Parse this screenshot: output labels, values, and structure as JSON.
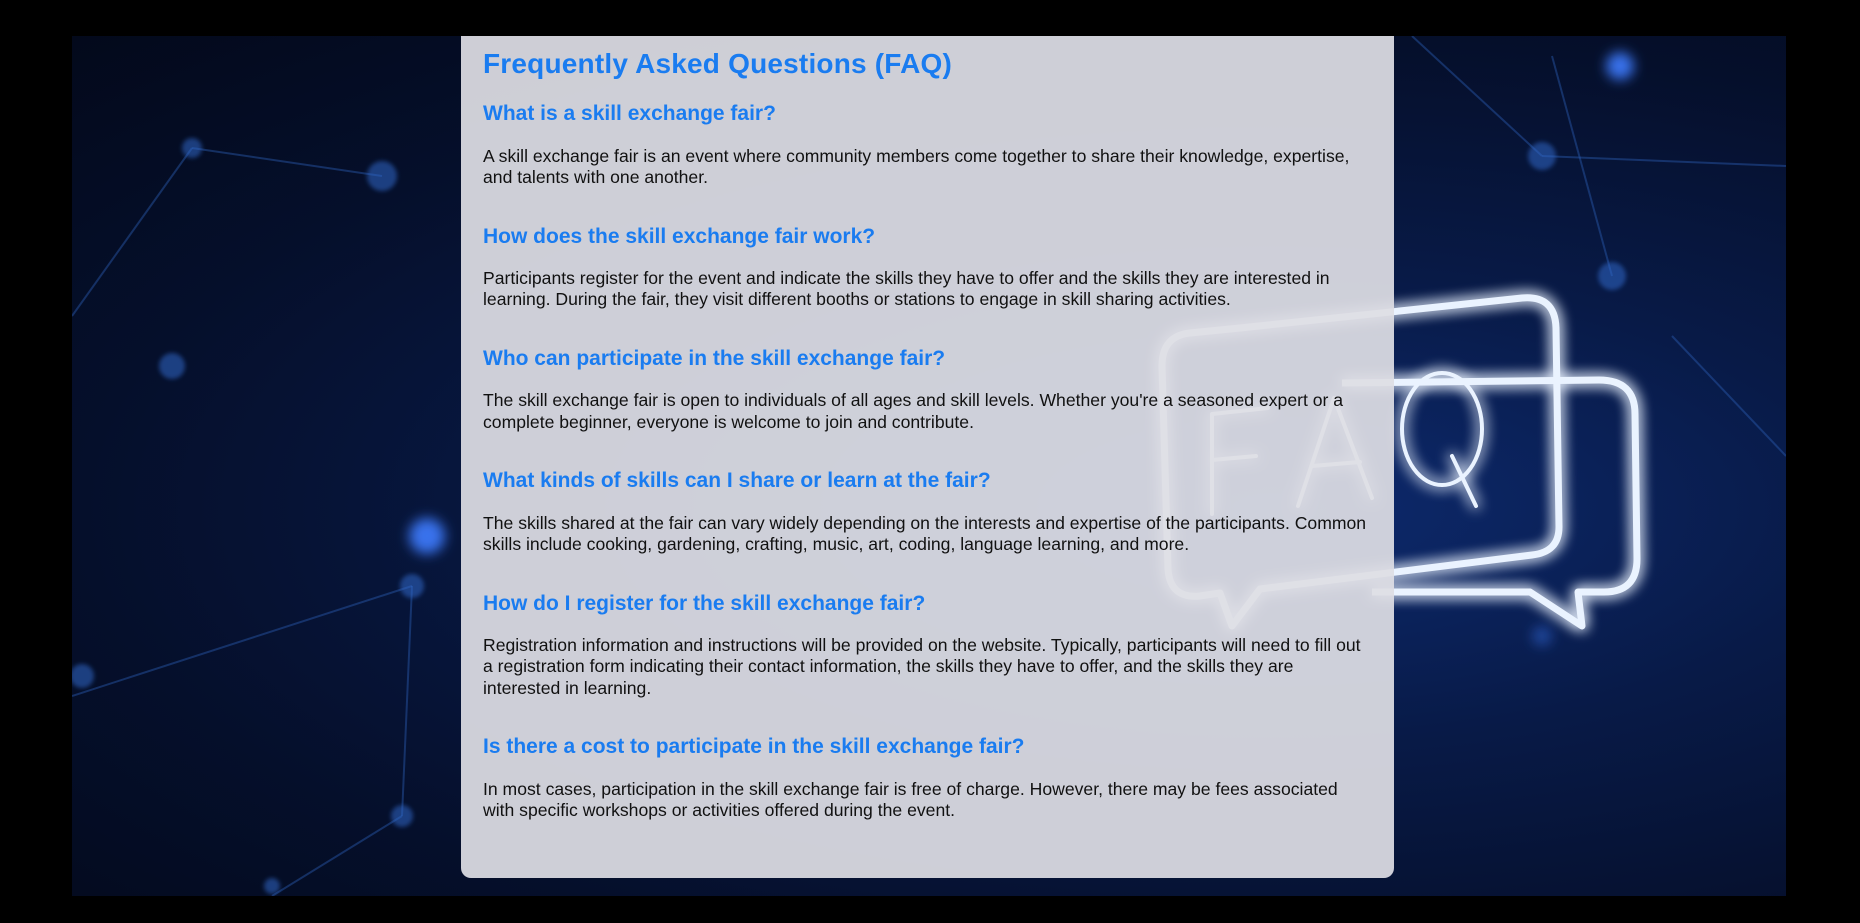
{
  "page": {
    "title": "Frequently Asked Questions (FAQ)"
  },
  "faqs": [
    {
      "question": "What is a skill exchange fair?",
      "answer": "A skill exchange fair is an event where community members come together to share their knowledge, expertise, and talents with one another."
    },
    {
      "question": "How does the skill exchange fair work?",
      "answer": "Participants register for the event and indicate the skills they have to offer and the skills they are interested in learning. During the fair, they visit different booths or stations to engage in skill sharing activities."
    },
    {
      "question": "Who can participate in the skill exchange fair?",
      "answer": "The skill exchange fair is open to individuals of all ages and skill levels. Whether you're a seasoned expert or a complete beginner, everyone is welcome to join and contribute."
    },
    {
      "question": "What kinds of skills can I share or learn at the fair?",
      "answer": "The skills shared at the fair can vary widely depending on the interests and expertise of the participants. Common skills include cooking, gardening, crafting, music, art, coding, language learning, and more."
    },
    {
      "question": "How do I register for the skill exchange fair?",
      "answer": "Registration information and instructions will be provided on the website. Typically, participants will need to fill out a registration form indicating their contact information, the skills they have to offer, and the skills they are interested in learning."
    },
    {
      "question": "Is there a cost to participate in the skill exchange fair?",
      "answer": "In most cases, participation in the skill exchange fair is free of charge. However, there may be fees associated with specific workshops or activities offered during the event."
    }
  ],
  "background": {
    "neon_text": "FAQ",
    "icon": "speech-bubbles-icon",
    "colors": {
      "accent": "#1a7cf0",
      "neon": "#eaf3ff",
      "glow": "#3f8cff"
    }
  }
}
